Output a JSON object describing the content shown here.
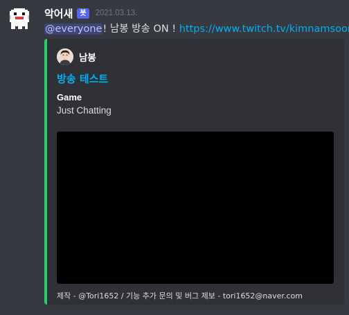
{
  "message": {
    "username": "악어새",
    "bot_tag": "봇",
    "timestamp": "2021.03.13.",
    "mention": "@everyone",
    "text": "! 남봉 방송 ON ! ",
    "link": "https://www.twitch.tv/kimnamsoon",
    "avatar_icon": "pixel-ghost-avatar-icon"
  },
  "embed": {
    "accent_color": "#2ecc71",
    "author_name": "남봉",
    "title": "방송 테스트",
    "fields": [
      {
        "name": "Game",
        "value": "Just Chatting"
      }
    ],
    "footer": "제작 - @Tori1652 / 기능 추가 문의 및 버그 제보 - tori1652@naver.com"
  },
  "colors": {
    "background": "#36393f",
    "embed_background": "#2f3136",
    "link": "#00b0f4",
    "bot_tag": "#5865f2"
  }
}
